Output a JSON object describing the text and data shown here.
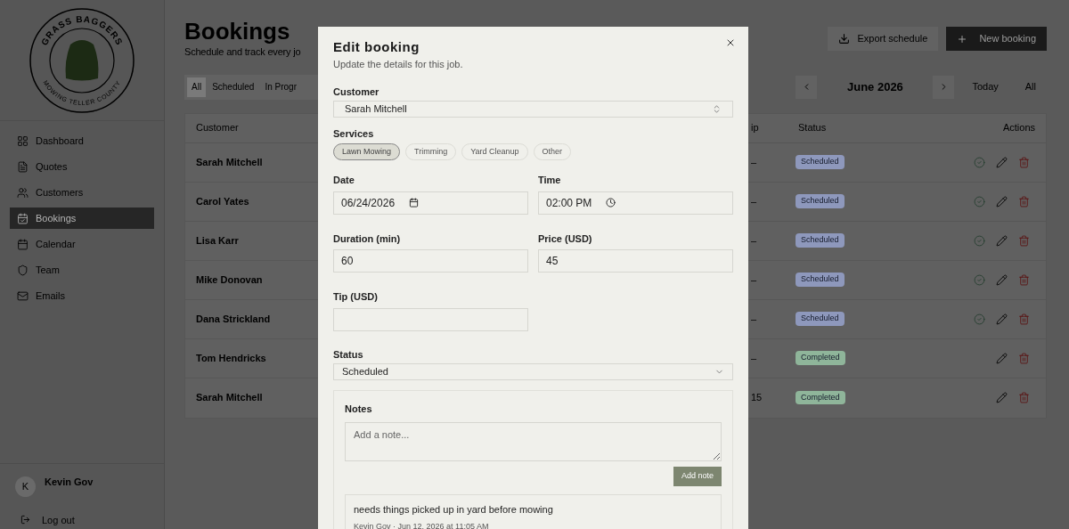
{
  "logo": {
    "top_text": "GRASS BAGGERS",
    "bottom_text": "MOWING TELLER COUNTY"
  },
  "sidebar": {
    "items": [
      {
        "label": "Dashboard",
        "selected": false
      },
      {
        "label": "Quotes",
        "selected": false
      },
      {
        "label": "Customers",
        "selected": false
      },
      {
        "label": "Bookings",
        "selected": true
      },
      {
        "label": "Calendar",
        "selected": false
      },
      {
        "label": "Team",
        "selected": false
      },
      {
        "label": "Emails",
        "selected": false
      }
    ],
    "user": {
      "initial": "K",
      "name": "Kevin Gov"
    },
    "logout": "Log out"
  },
  "page": {
    "title": "Bookings",
    "subtitle": "Schedule and track every jo",
    "export_button": "Export schedule",
    "new_button": "New booking"
  },
  "filter_tabs": [
    {
      "label": "All",
      "selected": true
    },
    {
      "label": "Scheduled",
      "selected": false
    },
    {
      "label": "In Progr",
      "selected": false
    }
  ],
  "month_nav": {
    "month": "June 2026",
    "today": "Today",
    "all": "All"
  },
  "table": {
    "columns": [
      "Customer",
      "ip",
      "Status",
      "Actions"
    ],
    "rows": [
      {
        "customer": "Sarah Mitchell",
        "tip": "–",
        "status": "Scheduled",
        "color": "#8e98bc",
        "can_complete": true
      },
      {
        "customer": "Carol Yates",
        "tip": "–",
        "status": "Scheduled",
        "color": "#8e98bc",
        "can_complete": true
      },
      {
        "customer": "Lisa Karr",
        "tip": "–",
        "status": "Scheduled",
        "color": "#8e98bc",
        "can_complete": true
      },
      {
        "customer": "Mike Donovan",
        "tip": "–",
        "status": "Scheduled",
        "color": "#8e98bc",
        "can_complete": true
      },
      {
        "customer": "Dana Strickland",
        "tip": "–",
        "status": "Scheduled",
        "color": "#8e98bc",
        "can_complete": true
      },
      {
        "customer": "Tom Hendricks",
        "tip": "–",
        "status": "Completed",
        "color": "#8fb59a",
        "can_complete": false
      },
      {
        "customer": "Sarah Mitchell",
        "tip": "15",
        "status": "Completed",
        "color": "#8fb59a",
        "can_complete": false
      }
    ]
  },
  "dialog": {
    "title": "Edit booking",
    "subtitle": "Update the details for this job.",
    "customer": {
      "label": "Customer",
      "value": "Sarah Mitchell"
    },
    "services": {
      "label": "Services",
      "options": [
        {
          "label": "Lawn Mowing",
          "selected": true
        },
        {
          "label": "Trimming",
          "selected": false
        },
        {
          "label": "Yard Cleanup",
          "selected": false
        },
        {
          "label": "Other",
          "selected": false
        }
      ]
    },
    "date": {
      "label": "Date",
      "value": "06/24/2026"
    },
    "time": {
      "label": "Time",
      "value": "02:00 PM"
    },
    "duration": {
      "label": "Duration (min)",
      "value": "60"
    },
    "price": {
      "label": "Price (USD)",
      "value": "45"
    },
    "tip": {
      "label": "Tip (USD)"
    },
    "status": {
      "label": "Status",
      "value": "Scheduled"
    },
    "notes": {
      "label": "Notes",
      "placeholder": "Add a note...",
      "add_button": "Add note",
      "items": [
        {
          "text": "needs things picked up in yard before mowing",
          "meta": "Kevin Gov · Jun 12, 2026 at 11:05 AM"
        }
      ]
    }
  }
}
